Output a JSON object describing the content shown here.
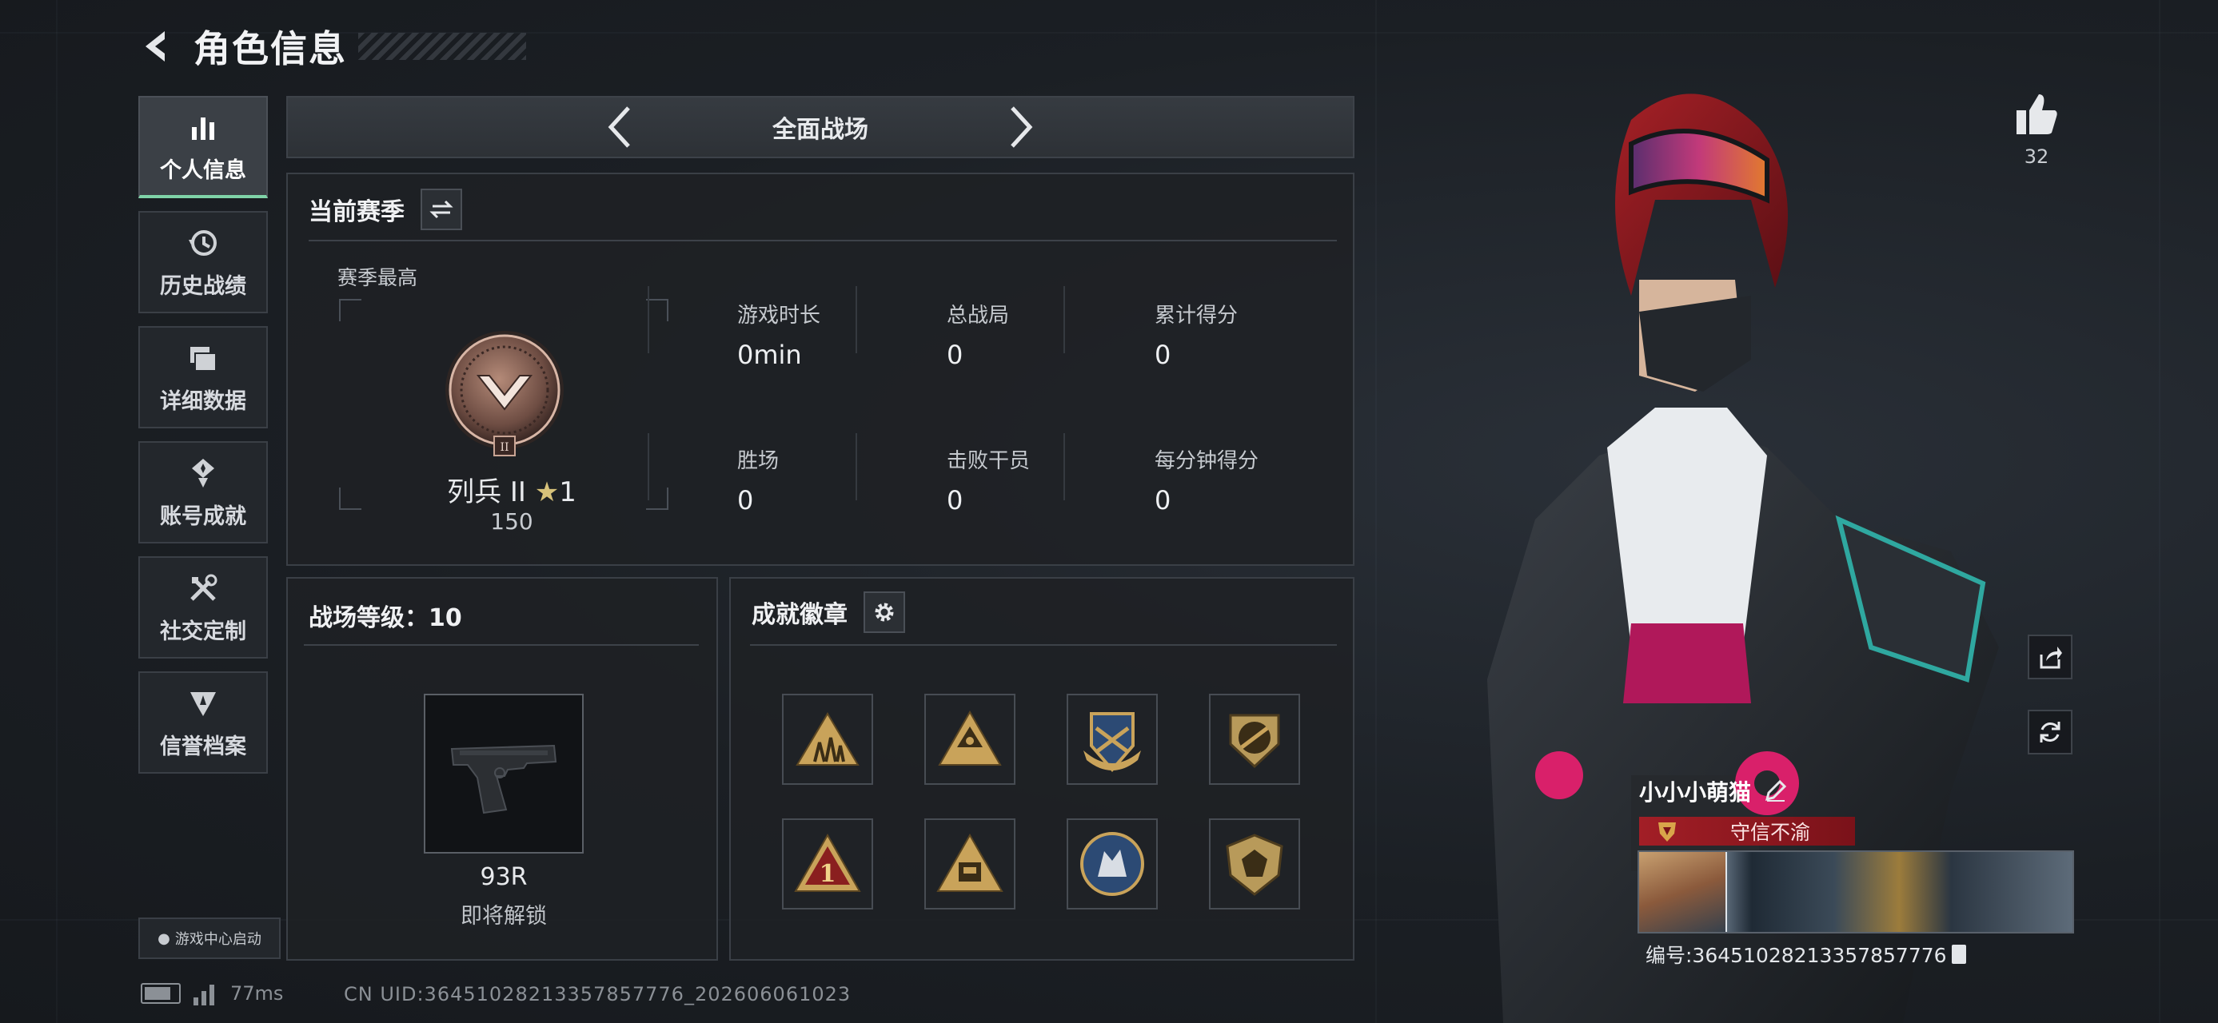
{
  "header": {
    "title": "角色信息"
  },
  "sidebar": {
    "items": [
      {
        "label": "个人信息",
        "icon": "bar-chart-icon",
        "active": true
      },
      {
        "label": "历史战绩",
        "icon": "history-clock-icon"
      },
      {
        "label": "详细数据",
        "icon": "folder-icon"
      },
      {
        "label": "账号成就",
        "icon": "achievement-medal-icon"
      },
      {
        "label": "社交定制",
        "icon": "tools-icon"
      },
      {
        "label": "信誉档案",
        "icon": "credit-shield-icon"
      }
    ],
    "game_center": "游戏中心启动"
  },
  "status": {
    "ping": "77ms",
    "uid_line": "CN UID:3645102821335785777​6_202606061023"
  },
  "mode": {
    "title": "全面战场"
  },
  "season": {
    "title": "当前赛季",
    "best_label": "赛季最高",
    "rank_name": "列兵 II",
    "rank_stars": "1",
    "rank_score": "150",
    "stats": [
      {
        "label": "游戏时长",
        "value": "0min"
      },
      {
        "label": "总战局",
        "value": "0"
      },
      {
        "label": "累计得分",
        "value": "0"
      },
      {
        "label": "胜场",
        "value": "0"
      },
      {
        "label": "击败干员",
        "value": "0"
      },
      {
        "label": "每分钟得分",
        "value": "0"
      }
    ]
  },
  "level": {
    "title": "战场等级：10",
    "weapon_name": "93R",
    "weapon_status": "即将解锁"
  },
  "badges": {
    "title": "成就徽章",
    "items": [
      "squad-triangle-medal",
      "triangle-eye-medal",
      "crossed-wings-medal",
      "rifle-shield-medal",
      "number-one-medal",
      "tank-triangle-medal",
      "wolf-circle-medal",
      "gem-shield-medal"
    ]
  },
  "profile": {
    "likes": "32",
    "player_name": "小小小萌猫",
    "honor": "守信不渝",
    "id_line": "编号:3645102821335785777​6"
  },
  "colors": {
    "accent": "#7fd3a8",
    "honor_red": "#a21e26",
    "medal_gold": "#c9a35a"
  }
}
